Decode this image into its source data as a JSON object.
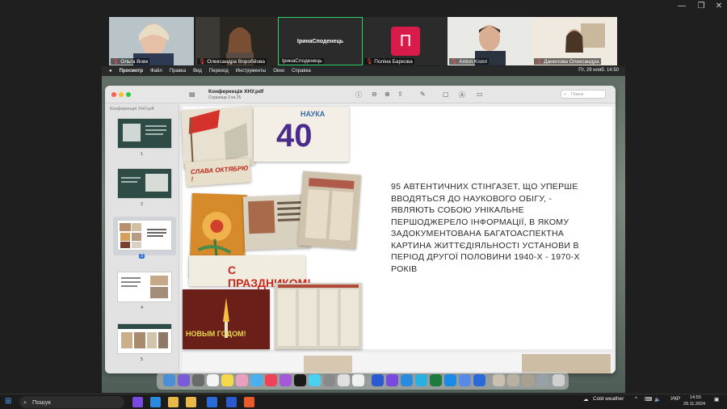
{
  "zoom": {
    "participants": [
      {
        "name": "Ольга Вовк",
        "muted": true
      },
      {
        "name": "Олександра Воробйова",
        "muted": true
      },
      {
        "name": "ІринаСподенець",
        "muted": false,
        "active": true
      },
      {
        "name": "Поліна Баркова",
        "muted": true,
        "avatar_letter": "П"
      },
      {
        "name": "Anton Kistol",
        "muted": true
      },
      {
        "name": "Данилова Олександра",
        "muted": true
      }
    ],
    "window_controls": [
      "—",
      "❐",
      "✕"
    ]
  },
  "mac_menubar": {
    "items": [
      "Просмотр",
      "Файл",
      "Правка",
      "Вид",
      "Переход",
      "Инструменты",
      "Окно",
      "Справка"
    ],
    "datetime": "Пт, 29 нояб. 14:50"
  },
  "preview": {
    "title": "Конференція ХНУ.pdf",
    "subtitle": "Страница 3 из 25",
    "sidebar_title": "Конференція ХНУ.pdf",
    "search_placeholder": "Поиск",
    "thumbnails": [
      {
        "num": "1"
      },
      {
        "num": "2"
      },
      {
        "num": "3",
        "selected": true
      },
      {
        "num": "4"
      },
      {
        "num": "5"
      }
    ],
    "slide_text": "95 АВТЕНТИЧНИХ СТІНГАЗЕТ, ЩО УПЕРШЕ ВВОДЯТЬСЯ ДО НАУКОВОГО ОБІГУ, -  ЯВЛЯЮТЬ СОБОЮ УНІКАЛЬНЕ ПЕРШОДЖЕРЕЛО ІНФОРМАЦІЇ, В ЯКОМУ ЗАДОКУМЕНТОВАНА БАГАТОАСПЕКТНА КАРТИНА ЖИТТЄДІЯЛЬНОСТІ УСТАНОВИ В ПЕРІОД ДРУГОЇ ПОЛОВИНИ 1940-Х - 1970-Х РОКІВ",
    "collage_labels": {
      "nauka": "НАУКА",
      "forty": "40",
      "slava": "СЛАВА ОКТЯБРЮ !",
      "prazdnik": "С ПРАЗДНИКОМ!",
      "new_year": "НОВЫМ ГОДОМ!",
      "nauka2": "НАУКА"
    }
  },
  "taskbar": {
    "search_label": "Пошук",
    "weather": "Cold weather",
    "lang": "УКР",
    "time": "14:50",
    "date": "29.11.2024"
  },
  "colors": {
    "active_border": "#2fd36b",
    "avatar_p": "#d81b4a",
    "mic_muted": "#ff4a4a"
  }
}
